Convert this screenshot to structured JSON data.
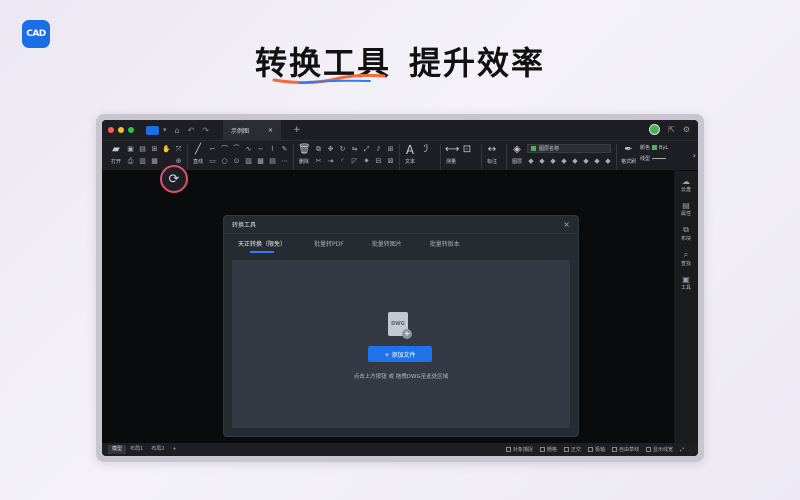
{
  "hero": {
    "logo_text": "CAD",
    "title_part1": "转换工具",
    "title_part2": "提升效率",
    "accent_color": "#1a6fe6",
    "swoosh_color": "#f06a3a"
  },
  "window": {
    "tab_title": "示例图",
    "tab_close": "×",
    "tab_add": "+"
  },
  "ribbon": {
    "open": "打开",
    "line": "直线",
    "delete": "删除",
    "text": "文本",
    "measure": "测量",
    "annotate": "标注",
    "layer": "图层",
    "layer_select": "图层名称",
    "format_painter": "格式刷",
    "color": "颜色",
    "color_value": "ByL",
    "linetype": "线型"
  },
  "rightbar": {
    "items": [
      "云盘",
      "属性",
      "布块",
      "查找",
      "工具"
    ]
  },
  "dialog": {
    "title": "转换工具",
    "close": "×",
    "tabs": [
      "天正转换（限免）",
      "批量转PDF",
      "批量转图片",
      "批量转版本"
    ],
    "file_label": "DWG",
    "add_button": "+ 添加文件",
    "hint": "点击上方按钮 或 拖拽DWG至此处区域"
  },
  "statusbar": {
    "tabs": [
      "模型",
      "布局1",
      "布局2"
    ],
    "add": "+",
    "toggles": [
      "对象捕捉",
      "栅格",
      "正交",
      "极轴",
      "自由草线",
      "显示线宽"
    ]
  }
}
